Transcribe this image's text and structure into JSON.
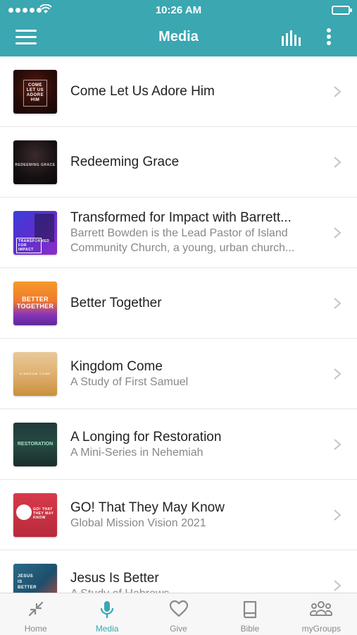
{
  "status_bar": {
    "time": "10:26 AM"
  },
  "header": {
    "title": "Media"
  },
  "media_items": [
    {
      "title": "Come Let Us Adore Him",
      "subtitle": "",
      "thumb_text": "COME LET US ADORE HIM"
    },
    {
      "title": "Redeeming Grace",
      "subtitle": "",
      "thumb_text": "REDEEMING GRACE"
    },
    {
      "title": "Transformed for Impact with Barrett...",
      "subtitle": "Barrett Bowden is the Lead Pastor of Island Community Church, a young, urban church...",
      "thumb_text": "TRANSFORMED FOR IMPACT"
    },
    {
      "title": "Better Together",
      "subtitle": "",
      "thumb_text": "BETTER TOGETHER"
    },
    {
      "title": "Kingdom Come",
      "subtitle": "A Study of First Samuel",
      "thumb_text": "KINGDOM COME"
    },
    {
      "title": "A Longing for Restoration",
      "subtitle": "A Mini-Series in Nehemiah",
      "thumb_text": "RESTORATION"
    },
    {
      "title": "GO! That They May Know",
      "subtitle": "Global Mission Vision 2021",
      "thumb_text": "GO! THAT THEY MAY KNOW"
    },
    {
      "title": "Jesus Is Better",
      "subtitle": "A Study of Hebrews",
      "thumb_text": "JESUS IS BETTER"
    }
  ],
  "tabs": [
    {
      "label": "Home",
      "icon": "collapse-arrows-icon",
      "active": false
    },
    {
      "label": "Media",
      "icon": "microphone-icon",
      "active": true
    },
    {
      "label": "Give",
      "icon": "heart-icon",
      "active": false
    },
    {
      "label": "Bible",
      "icon": "book-icon",
      "active": false
    },
    {
      "label": "myGroups",
      "icon": "people-icon",
      "active": false
    }
  ],
  "colors": {
    "accent": "#3aa7b1",
    "inactive_tab": "#8a8a8a",
    "title_text": "#222222",
    "subtitle_text": "#888888"
  }
}
